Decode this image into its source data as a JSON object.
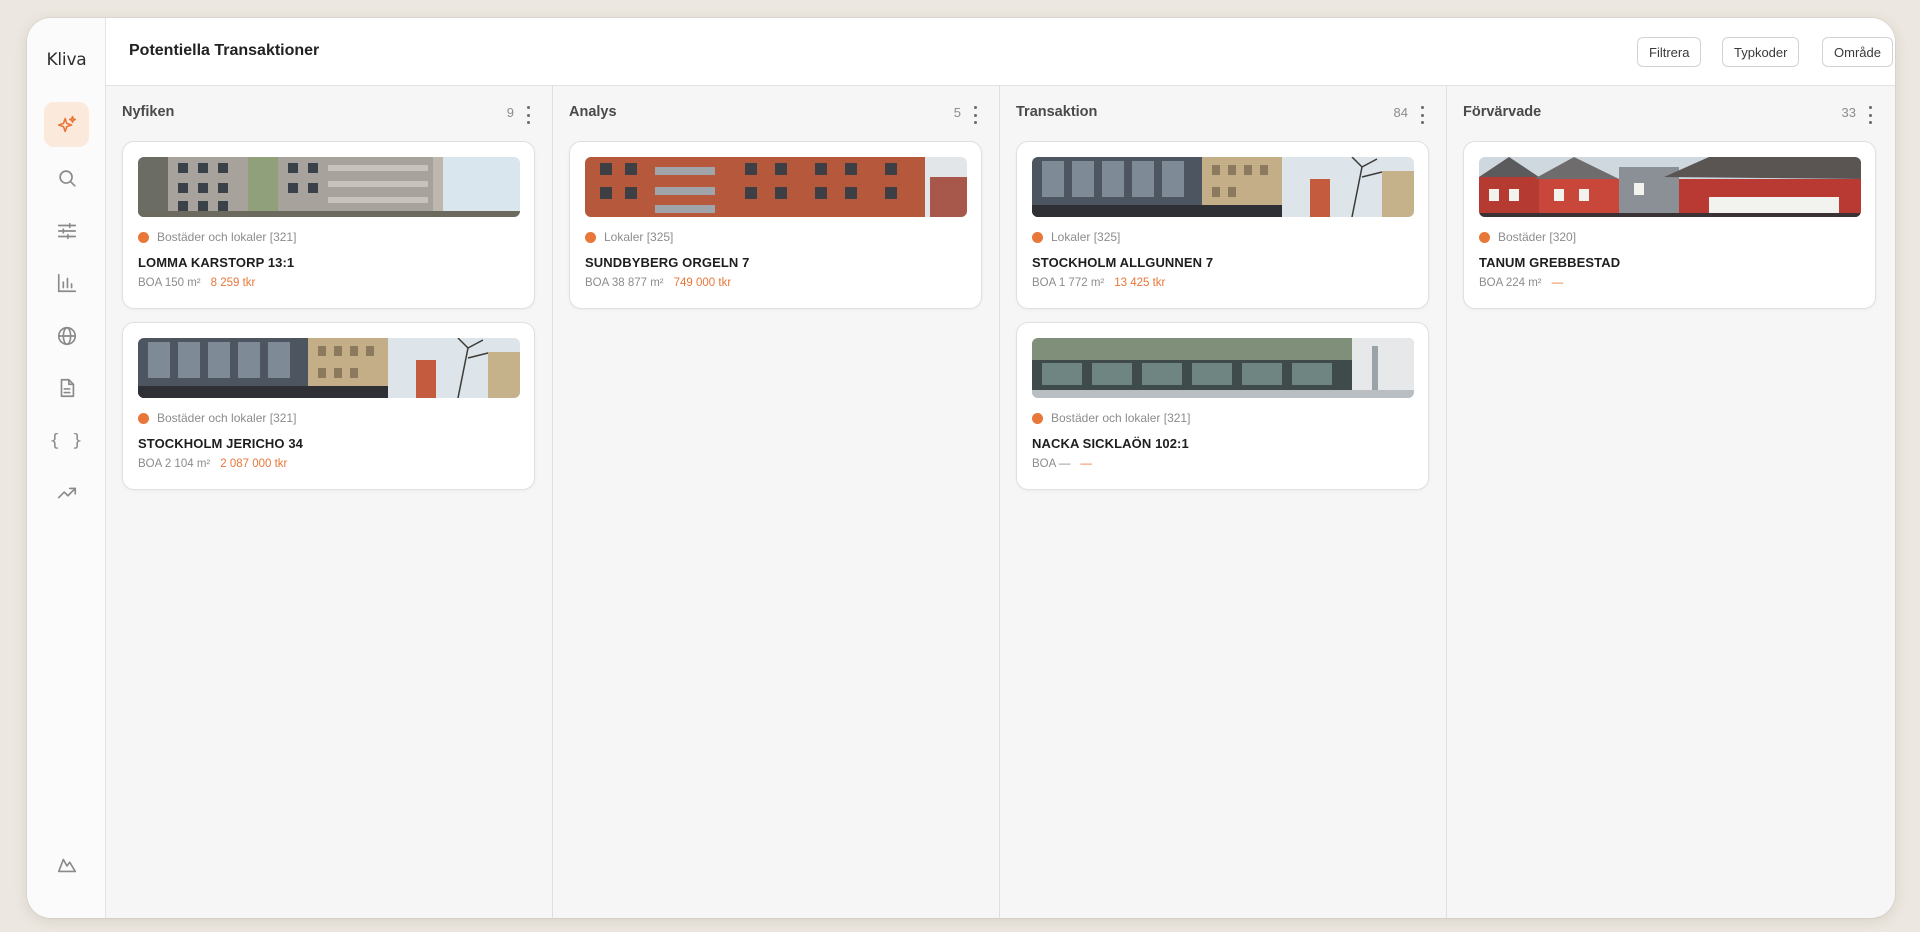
{
  "app": {
    "logo": "Kliva"
  },
  "header": {
    "title": "Potentiella Transaktioner",
    "buttons": {
      "filter": "Filtrera",
      "typecodes": "Typkoder",
      "area": "Område"
    }
  },
  "sidebar": {
    "items": [
      {
        "icon": "sparkle-icon",
        "active": true
      },
      {
        "icon": "search-icon",
        "active": false
      },
      {
        "icon": "sliders-icon",
        "active": false
      },
      {
        "icon": "bar-chart-icon",
        "active": false
      },
      {
        "icon": "globe-icon",
        "active": false
      },
      {
        "icon": "document-icon",
        "active": false
      },
      {
        "icon": "code-braces-icon",
        "active": false
      },
      {
        "icon": "trending-up-icon",
        "active": false
      }
    ],
    "bottom_icon": "mountain-icon"
  },
  "colors": {
    "accent": "#e8773a",
    "active_bg": "#fbe9dc"
  },
  "columns": [
    {
      "title": "Nyfiken",
      "count": "9",
      "cards": [
        {
          "type": "Bostäder och lokaler [321]",
          "name": "LOMMA KARSTORP 13:1",
          "boa": "BOA 150 m²",
          "price": "8 259 tkr",
          "image": "residential-balconies"
        },
        {
          "type": "Bostäder och lokaler [321]",
          "name": "STOCKHOLM JERICHO 34",
          "boa": "BOA 2 104 m²",
          "price": "2 087 000 tkr",
          "image": "glass-office-street"
        }
      ]
    },
    {
      "title": "Analys",
      "count": "5",
      "cards": [
        {
          "type": "Lokaler [325]",
          "name": "SUNDBYBERG ORGELN 7",
          "boa": "BOA 38 877 m²",
          "price": "749 000 tkr",
          "image": "red-brick-building"
        }
      ]
    },
    {
      "title": "Transaktion",
      "count": "84",
      "cards": [
        {
          "type": "Lokaler [325]",
          "name": "STOCKHOLM ALLGUNNEN 7",
          "boa": "BOA 1 772 m²",
          "price": "13 425 tkr",
          "image": "glass-office-street"
        },
        {
          "type": "Bostäder och lokaler [321]",
          "name": "NACKA SICKLAÖN 102:1",
          "boa": "BOA —",
          "price": "—",
          "image": "glass-facade-trees"
        }
      ]
    },
    {
      "title": "Förvärvade",
      "count": "33",
      "cards": [
        {
          "type": "Bostäder [320]",
          "name": "TANUM GREBBESTAD",
          "boa": "BOA 224 m²",
          "price": "—",
          "image": "red-wooden-houses"
        }
      ]
    }
  ]
}
